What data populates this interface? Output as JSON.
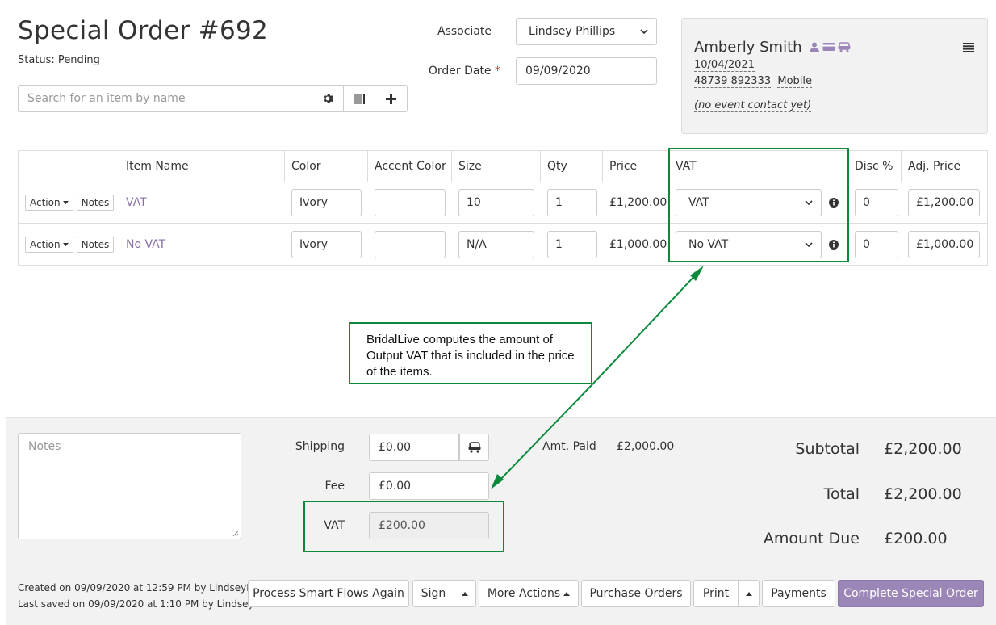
{
  "header": {
    "title": "Special Order #692",
    "status": "Status: Pending"
  },
  "search": {
    "placeholder": "Search for an item by name",
    "buttons": [
      "gear-icon",
      "barcode-icon",
      "plus-icon"
    ]
  },
  "form": {
    "associate_label": "Associate",
    "associate_value": "Lindsey Phillips",
    "order_date_label": "Order Date",
    "order_date_required": "*",
    "order_date_value": "09/09/2020"
  },
  "customer": {
    "name": "Amberly Smith",
    "date": "10/04/2021",
    "phone": "48739 892333",
    "phone_type": "Mobile",
    "event_contact": "(no event contact yet)",
    "icons": [
      "person-icon",
      "card-icon",
      "car-icon"
    ]
  },
  "table": {
    "headers": [
      "",
      "Item Name",
      "Color",
      "Accent Color",
      "Size",
      "Qty",
      "Price",
      "VAT",
      "Disc %",
      "Adj. Price"
    ],
    "action_label": "Action",
    "notes_label": "Notes",
    "rows": [
      {
        "item": "VAT",
        "color": "Ivory",
        "accent": "",
        "size": "10",
        "qty": "1",
        "price": "£1,200.00",
        "vat": "VAT",
        "disc": "0",
        "adj_price": "£1,200.00"
      },
      {
        "item": "No VAT",
        "color": "Ivory",
        "accent": "",
        "size": "N/A",
        "qty": "1",
        "price": "£1,000.00",
        "vat": "No VAT",
        "disc": "0",
        "adj_price": "£1,000.00"
      }
    ]
  },
  "callout": {
    "text": "BridalLive computes the amount of Output VAT that is included in the price of the items."
  },
  "bottom": {
    "notes_placeholder": "Notes",
    "shipping_label": "Shipping",
    "shipping_value": "£0.00",
    "fee_label": "Fee",
    "fee_value": "£0.00",
    "vat_label": "VAT",
    "vat_value": "£200.00",
    "amt_paid_label": "Amt. Paid",
    "amt_paid_value": "£2,000.00",
    "subtotal_label": "Subtotal",
    "subtotal_value": "£2,200.00",
    "total_label": "Total",
    "total_value": "£2,200.00",
    "amount_due_label": "Amount Due",
    "amount_due_value": "£200.00",
    "created": "Created on 09/09/2020 at 12:59 PM by LindseyP",
    "saved": "Last saved on 09/09/2020 at 1:10 PM by LindseyP"
  },
  "actions": {
    "process_smart_flows": "Process Smart Flows Again",
    "sign": "Sign",
    "more_actions": "More Actions",
    "purchase_orders": "Purchase Orders",
    "print": "Print",
    "payments": "Payments",
    "complete": "Complete Special Order"
  },
  "colors": {
    "highlight": "#0a8a3a",
    "link": "#8a6fa8",
    "primary": "#9b86b8"
  }
}
